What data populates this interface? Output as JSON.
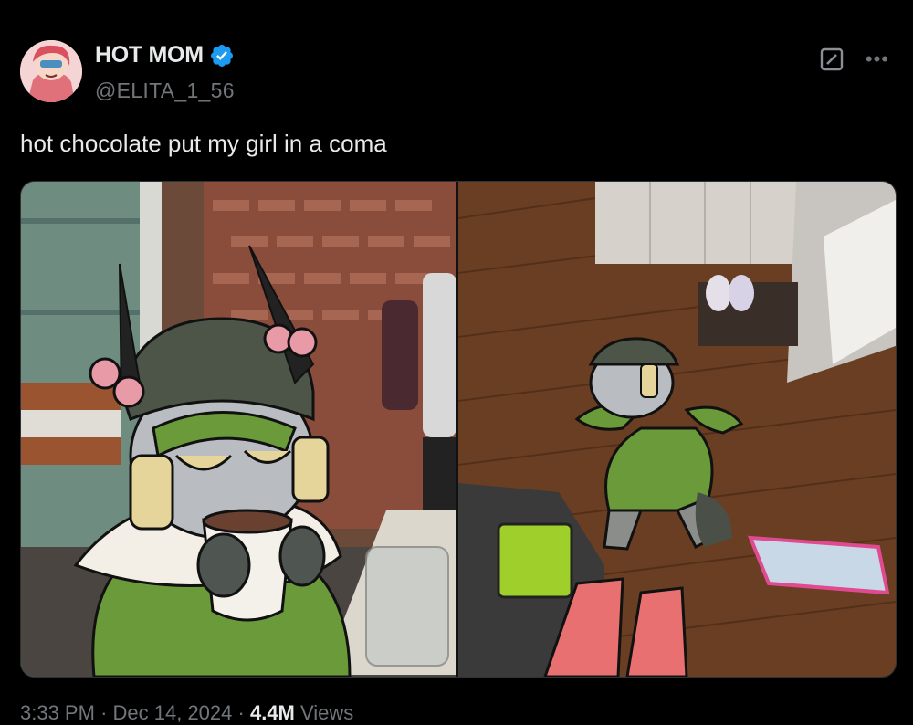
{
  "author": {
    "display_name": "HOT MOM",
    "handle": "@ELITA_1_56",
    "verified": true
  },
  "icons": {
    "verified": "verified-badge-icon",
    "grok": "grok-icon",
    "more": "more-icon"
  },
  "tweet": {
    "text": "hot chocolate put my girl in a coma"
  },
  "media": {
    "count": 2
  },
  "meta": {
    "time": "3:33 PM",
    "date": "Dec 14, 2024",
    "sep": "·",
    "views_count": "4.4M",
    "views_label": "Views"
  },
  "colors": {
    "background": "#000000",
    "text": "#e7e9ea",
    "muted": "#71767b",
    "verified": "#1d9bf0"
  },
  "more_glyph": "•••"
}
